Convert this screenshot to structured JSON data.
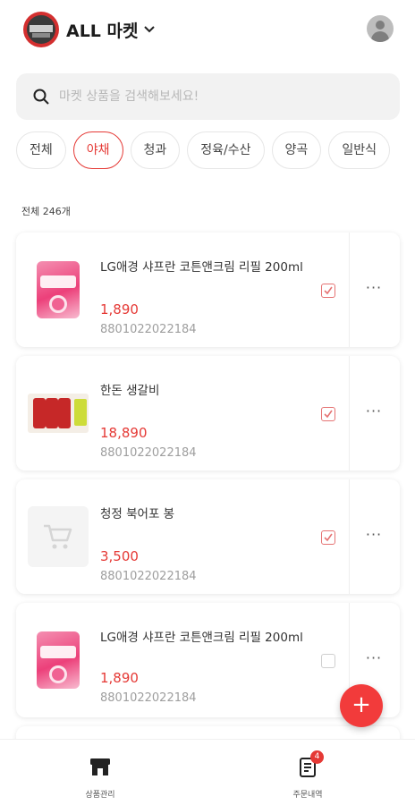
{
  "header": {
    "market_title": "ALL 마켓"
  },
  "search": {
    "placeholder": "마켓 상품을 검색해보세요!"
  },
  "categories": [
    {
      "label": "전체"
    },
    {
      "label": "야채",
      "active": true
    },
    {
      "label": "청과"
    },
    {
      "label": "정육/수산"
    },
    {
      "label": "양곡"
    },
    {
      "label": "일반식"
    }
  ],
  "list_count": "전체 246개",
  "products": [
    {
      "name": "LG애경 샤프란 코튼앤크림 리필 200ml",
      "price": "1,890",
      "barcode": "8801022022184",
      "checked": true,
      "image": "fabric-softener-pouch"
    },
    {
      "name": "한돈 생갈비",
      "price": "18,890",
      "barcode": "8801022022184",
      "checked": true,
      "image": "pork-ribs-tray"
    },
    {
      "name": "청정 북어포 봉",
      "price": "3,500",
      "barcode": "8801022022184",
      "checked": true,
      "image": "cart-placeholder-icon"
    },
    {
      "name": "LG애경 샤프란 코튼앤크림 리필 200ml",
      "price": "1,890",
      "barcode": "8801022022184",
      "checked": false,
      "image": "fabric-softener-pouch"
    }
  ],
  "more_glyph": "···",
  "fab": {
    "label": "+"
  },
  "bottom_nav": {
    "products_label": "상품관리",
    "orders_label": "주문내역",
    "orders_badge": "4"
  },
  "colors": {
    "accent": "#e53935",
    "fab": "#f23b3b"
  }
}
